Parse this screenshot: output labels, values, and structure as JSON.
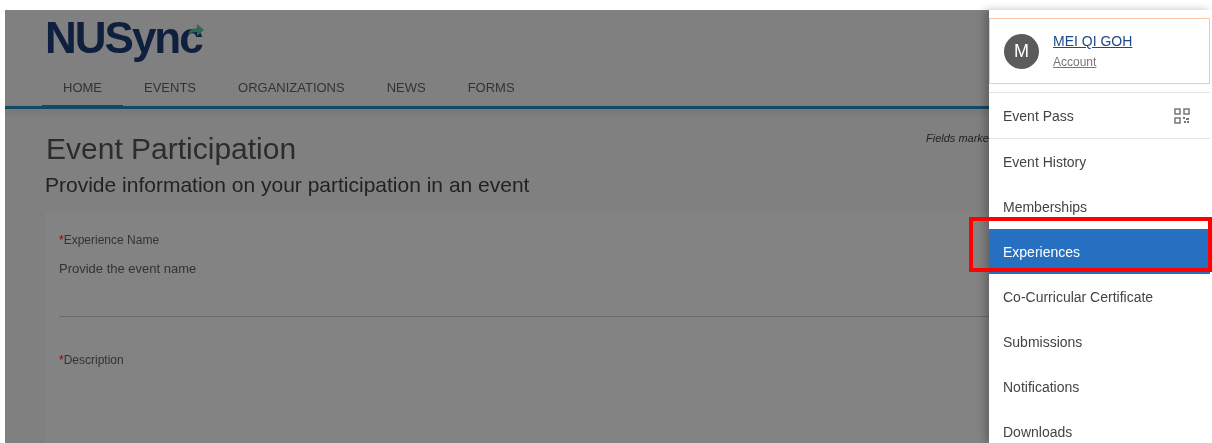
{
  "logo": {
    "text": "NUSync"
  },
  "nav": [
    {
      "label": "HOME",
      "selected": true
    },
    {
      "label": "EVENTS",
      "selected": false
    },
    {
      "label": "ORGANIZATIONS",
      "selected": false
    },
    {
      "label": "NEWS",
      "selected": false
    },
    {
      "label": "FORMS",
      "selected": false
    }
  ],
  "required_note": "Fields marke",
  "page_title": "Event Participation",
  "page_subtitle": "Provide information on your participation in an event",
  "form": {
    "fields": [
      {
        "required_mark": "*",
        "label": "Experience Name",
        "placeholder": "Provide the event name"
      },
      {
        "required_mark": "*",
        "label": "Description"
      }
    ]
  },
  "account_menu": {
    "avatar_initial": "M",
    "user_name": "MEI QI GOH",
    "account_link": "Account",
    "items": [
      {
        "label": "Event Pass",
        "kind": "qr",
        "selected": false,
        "highlighted": false
      },
      {
        "label": "Event History",
        "kind": "plain",
        "selected": false,
        "highlighted": false
      },
      {
        "label": "Memberships",
        "kind": "plain",
        "selected": false,
        "highlighted": false
      },
      {
        "label": "Experiences",
        "kind": "plain",
        "selected": true,
        "highlighted": true
      },
      {
        "label": "Co-Curricular Certificate",
        "kind": "plain",
        "selected": false,
        "highlighted": false
      },
      {
        "label": "Submissions",
        "kind": "plain",
        "selected": false,
        "highlighted": false
      },
      {
        "label": "Notifications",
        "kind": "plain",
        "selected": false,
        "highlighted": false
      },
      {
        "label": "Downloads",
        "kind": "plain",
        "selected": false,
        "highlighted": false
      }
    ]
  }
}
